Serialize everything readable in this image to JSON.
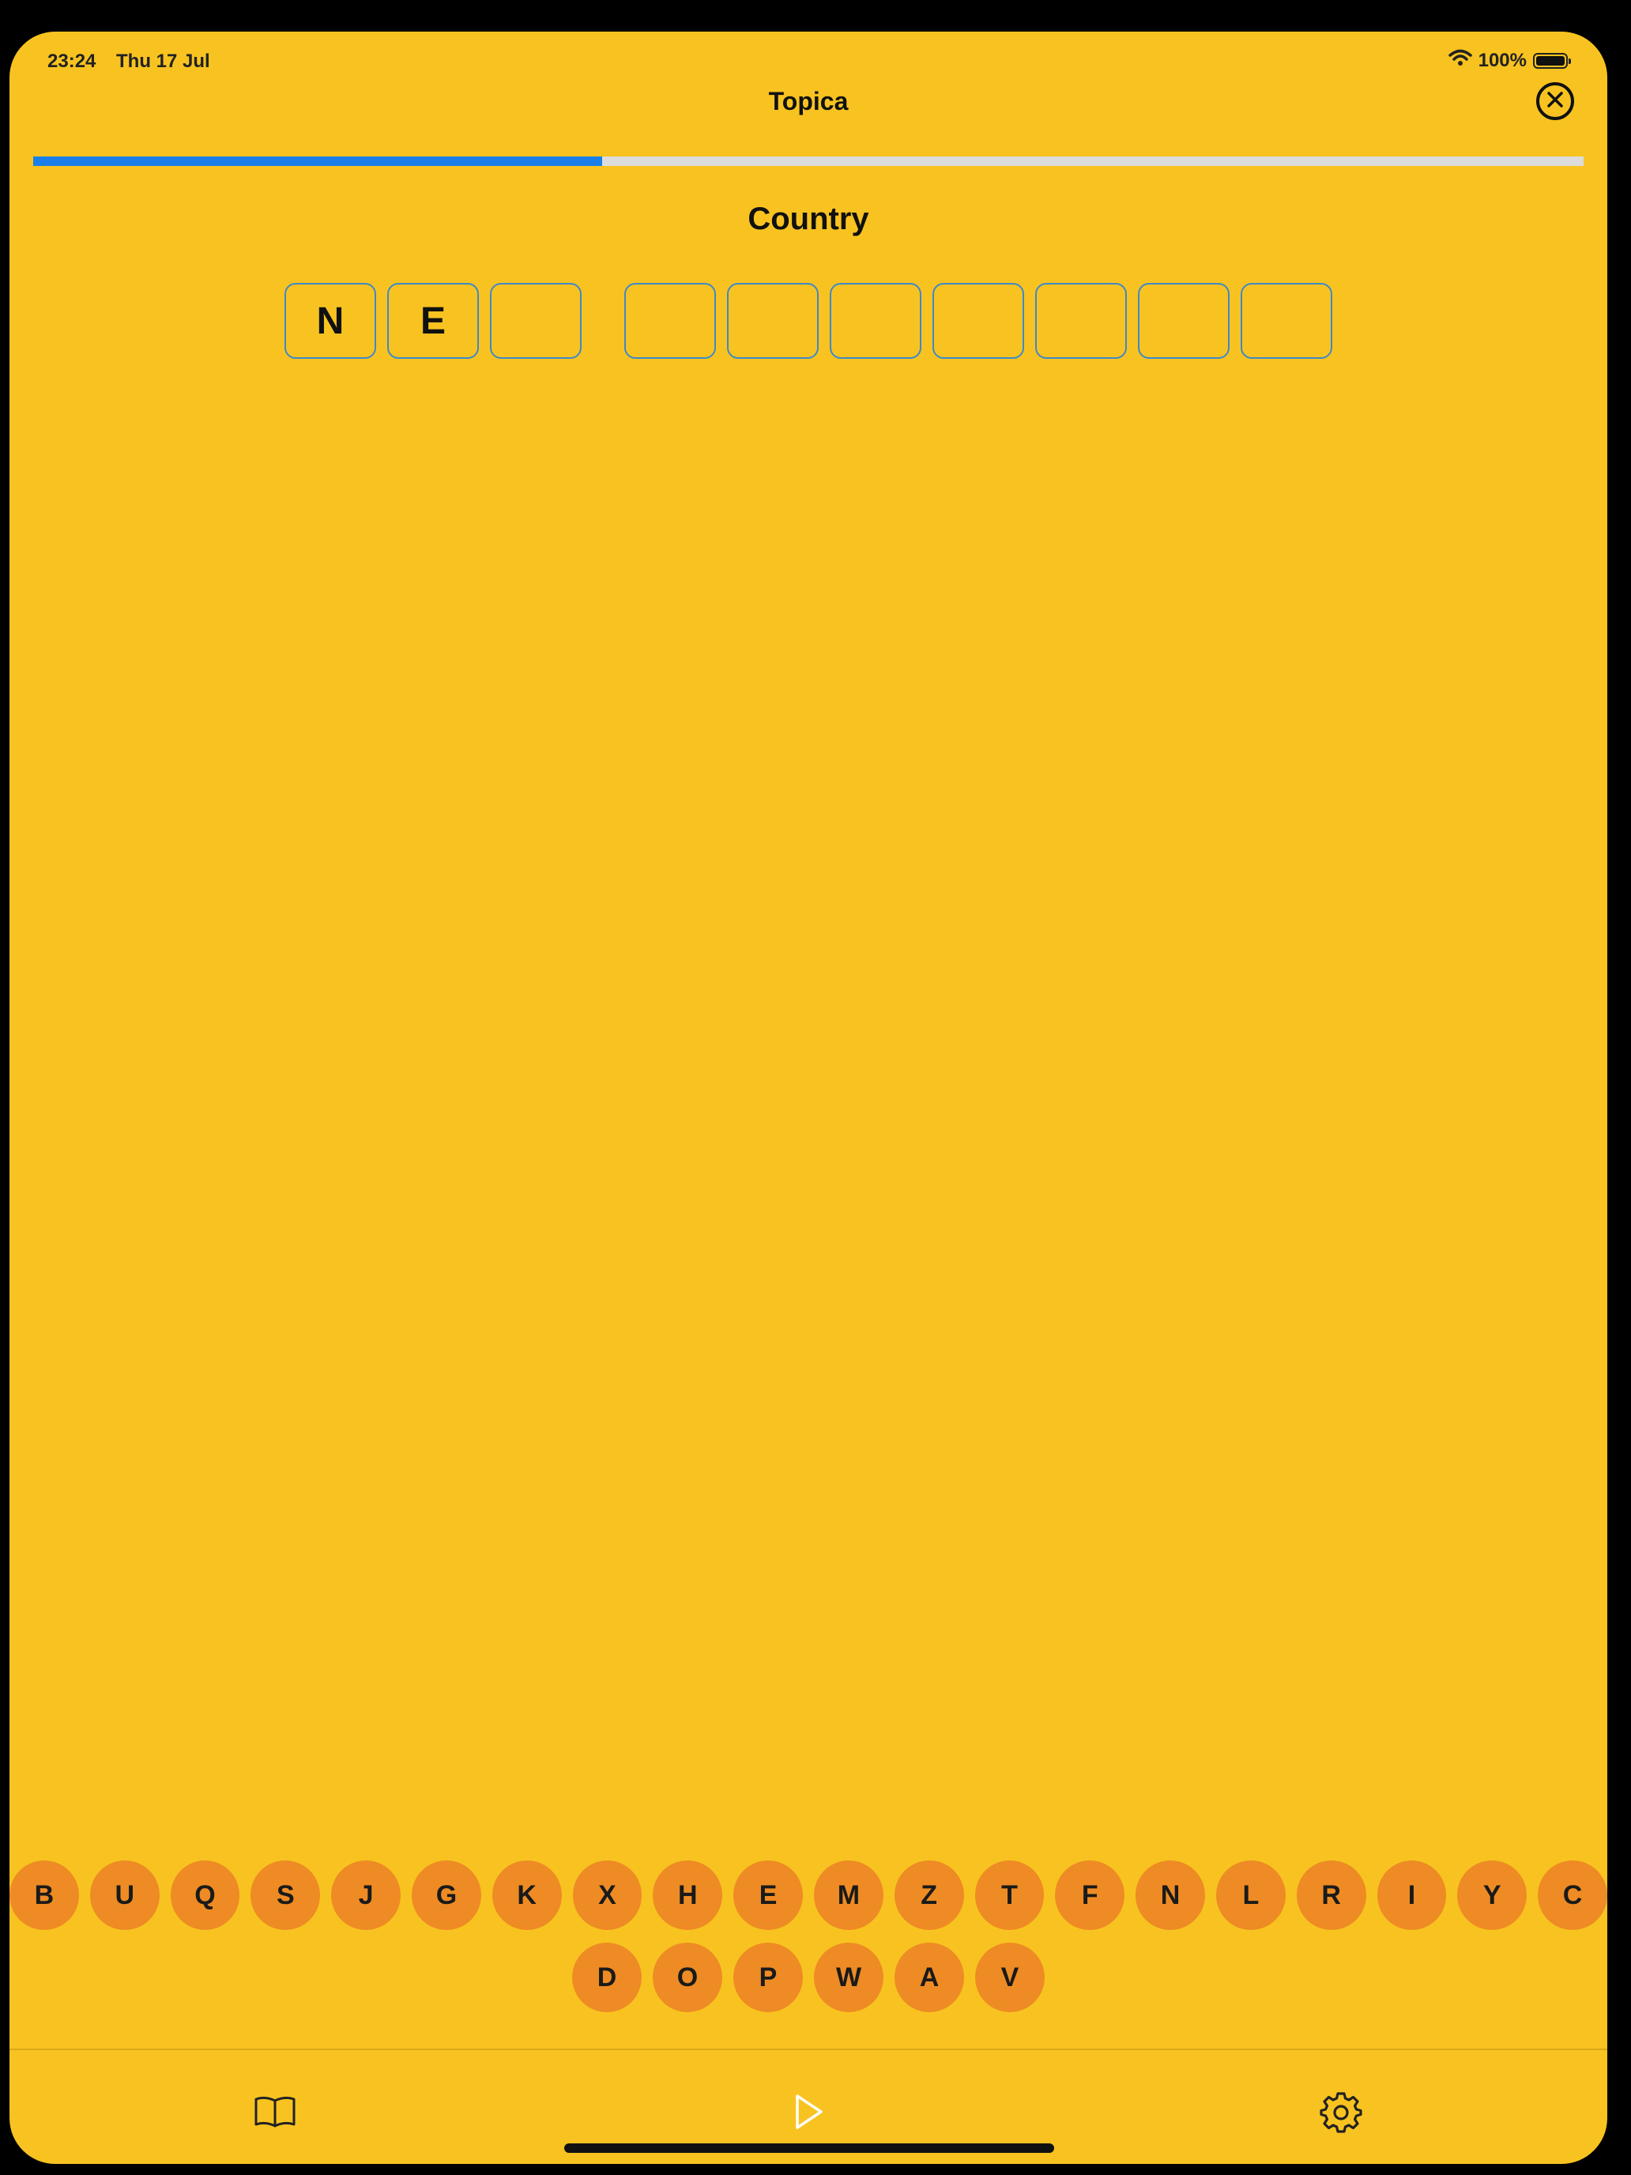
{
  "status_bar": {
    "time": "23:24",
    "date": "Thu 17 Jul",
    "battery": "100%"
  },
  "header": {
    "title": "Topica"
  },
  "progress": {
    "fraction": 0.367
  },
  "puzzle": {
    "category": "Country",
    "word1": [
      "N",
      "E",
      ""
    ],
    "word2": [
      "",
      "",
      "",
      "",
      "",
      "",
      ""
    ]
  },
  "keyboard": {
    "row1": [
      "B",
      "U",
      "Q",
      "S",
      "J",
      "G",
      "K",
      "X",
      "H",
      "E",
      "M",
      "Z",
      "T",
      "F",
      "N",
      "L",
      "R",
      "I",
      "Y",
      "C"
    ],
    "row2": [
      "D",
      "O",
      "P",
      "W",
      "A",
      "V"
    ]
  },
  "tabs": [
    {
      "name": "book-icon"
    },
    {
      "name": "play-icon"
    },
    {
      "name": "gear-icon"
    }
  ],
  "colors": {
    "background": "#F8C320",
    "key": "#EE8B24",
    "progress": "#1A7FE8",
    "slot_border": "#3F88C9"
  }
}
